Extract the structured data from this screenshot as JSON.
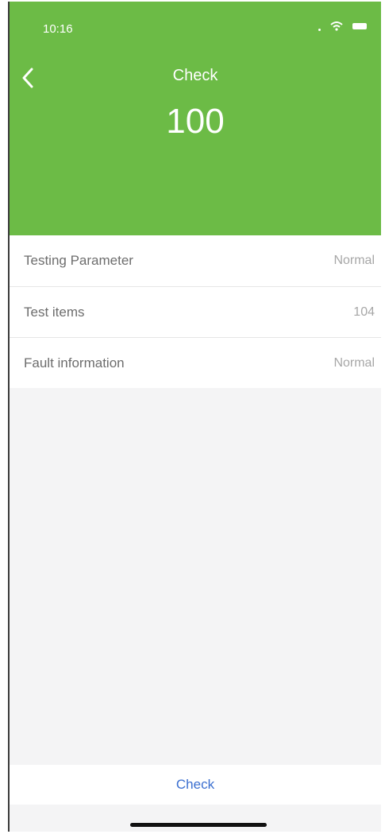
{
  "status_bar": {
    "time": "10:16",
    "icons": [
      "signal-dot-icon",
      "wifi-icon",
      "battery-icon"
    ]
  },
  "header": {
    "back_icon": "chevron-left-icon",
    "title": "Check",
    "score": "100",
    "background_color": "#6cbb46"
  },
  "list": {
    "items": [
      {
        "label": "Testing Parameter",
        "value": "Normal"
      },
      {
        "label": "Test items",
        "value": "104"
      },
      {
        "label": "Fault information",
        "value": "Normal"
      }
    ]
  },
  "footer": {
    "check_label": "Check",
    "accent_color": "#3b6fd0"
  }
}
